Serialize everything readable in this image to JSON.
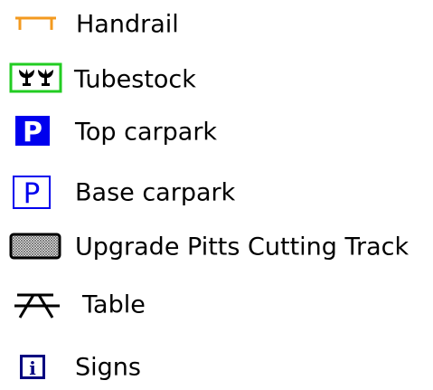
{
  "legend": {
    "items": [
      {
        "label": "Handrail",
        "icon": "handrail-icon",
        "color": "#f39a1f"
      },
      {
        "label": "Tubestock",
        "icon": "tubestock-icon",
        "color": "#22cc22"
      },
      {
        "label": "Top carpark",
        "icon": "parking-filled-icon",
        "color": "#0000ee"
      },
      {
        "label": "Base carpark",
        "icon": "parking-outline-icon",
        "color": "#0000ee"
      },
      {
        "label": "Upgrade Pitts Cutting Track",
        "icon": "hatched-area-icon",
        "color": "#000000"
      },
      {
        "label": "Table",
        "icon": "picnic-table-icon",
        "color": "#000000"
      },
      {
        "label": "Signs",
        "icon": "information-sign-icon",
        "color": "#000080"
      }
    ]
  }
}
